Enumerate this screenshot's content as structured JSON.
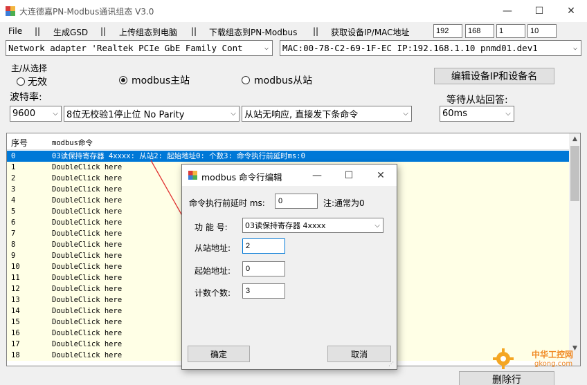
{
  "window": {
    "title": "大连德嘉PN-Modbus通讯组态  V3.0",
    "minimize": "—",
    "maximize": "☐",
    "close": "✕"
  },
  "menu": {
    "items": [
      "File",
      "||",
      "生成GSD",
      "||",
      "上传组态到电脑",
      "||",
      "下载组态到PN-Modbus",
      "||",
      "获取设备IP/MAC地址"
    ],
    "ip": [
      "192",
      "168",
      "1",
      "10"
    ]
  },
  "adapter": {
    "network": "Network adapter 'Realtek PCIe GbE Family Cont",
    "mac": "MAC:00-78-C2-69-1F-EC IP:192.168.1.10 pnmd01.dev1"
  },
  "mode": {
    "group_label": "主/从选择",
    "opt_none": "无效",
    "opt_master": "modbus主站",
    "opt_slave": "modbus从站",
    "edit_btn": "编辑设备IP和设备名",
    "selected": "master"
  },
  "serial": {
    "baud_label": "波特率:",
    "baud_value": "9600",
    "parity_value": "8位无校验1停止位 No Parity",
    "noresp_value": "从站无响应, 直接发下条命令",
    "wait_label": "等待从站回答:",
    "wait_value": "60ms"
  },
  "list": {
    "col_index": "序号",
    "col_cmd": "modbus命令",
    "rows": [
      {
        "idx": "0",
        "cmd": "03读保持寄存器 4xxxx: 从站2: 起始地址0: 个数3: 命令执行前延时ms:0"
      },
      {
        "idx": "1",
        "cmd": "DoubleClick here"
      },
      {
        "idx": "2",
        "cmd": "DoubleClick here"
      },
      {
        "idx": "3",
        "cmd": "DoubleClick here"
      },
      {
        "idx": "4",
        "cmd": "DoubleClick here"
      },
      {
        "idx": "5",
        "cmd": "DoubleClick here"
      },
      {
        "idx": "6",
        "cmd": "DoubleClick here"
      },
      {
        "idx": "7",
        "cmd": "DoubleClick here"
      },
      {
        "idx": "8",
        "cmd": "DoubleClick here"
      },
      {
        "idx": "9",
        "cmd": "DoubleClick here"
      },
      {
        "idx": "10",
        "cmd": "DoubleClick here"
      },
      {
        "idx": "11",
        "cmd": "DoubleClick here"
      },
      {
        "idx": "12",
        "cmd": "DoubleClick here"
      },
      {
        "idx": "13",
        "cmd": "DoubleClick here"
      },
      {
        "idx": "14",
        "cmd": "DoubleClick here"
      },
      {
        "idx": "15",
        "cmd": "DoubleClick here"
      },
      {
        "idx": "16",
        "cmd": "DoubleClick here"
      },
      {
        "idx": "17",
        "cmd": "DoubleClick here"
      },
      {
        "idx": "18",
        "cmd": "DoubleClick here"
      }
    ]
  },
  "delete_btn": "删除行",
  "dialog": {
    "title": "modbus 命令行编辑",
    "minimize": "—",
    "maximize": "☐",
    "close": "✕",
    "delay_label": "命令执行前延时 ms:",
    "delay_value": "0",
    "delay_note": "注:通常为0",
    "func_label": "功 能 号:",
    "func_value": "03读保持寄存器 4xxxx",
    "slave_label": "从站地址:",
    "slave_value": "2",
    "start_label": "起始地址:",
    "start_value": "0",
    "count_label": "计数个数:",
    "count_value": "3",
    "ok": "确定",
    "cancel": "取消"
  },
  "watermark": {
    "line1": "中华工控网",
    "line2": "gkong.com"
  },
  "colors": {
    "selection": "#0078d7",
    "row_bg": "#ffffe6",
    "annotation": "#e03030"
  }
}
